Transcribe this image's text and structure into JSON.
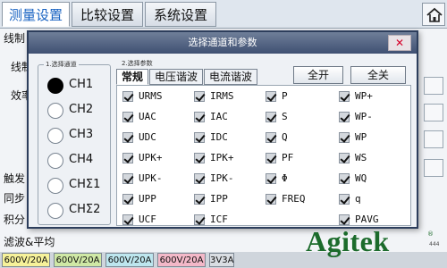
{
  "top_tabs": [
    {
      "label": "测量设置",
      "active": true
    },
    {
      "label": "比较设置",
      "active": false
    },
    {
      "label": "系统设置",
      "active": false
    }
  ],
  "bg_labels": [
    "线制",
    "线制",
    "效率",
    "触发",
    "同步",
    "积分",
    "滤波&平均"
  ],
  "status_cells": [
    {
      "label": "600V/20A",
      "color": "#f6f29a"
    },
    {
      "label": "600V/20A",
      "color": "#cfe8a5"
    },
    {
      "label": "600V/20A",
      "color": "#bde6ee"
    },
    {
      "label": "600V/20A",
      "color": "#f3b8c8"
    },
    {
      "label": "3V3A",
      "color": "#d9dde2"
    }
  ],
  "dialog": {
    "title": "选择通道和参数",
    "close": "✕",
    "channel_group_title": "1.选择通道",
    "channels": [
      {
        "label": "CH1",
        "selected": true
      },
      {
        "label": "CH2",
        "selected": false
      },
      {
        "label": "CH3",
        "selected": false
      },
      {
        "label": "CH4",
        "selected": false
      },
      {
        "label": "CHΣ1",
        "selected": false
      },
      {
        "label": "CHΣ2",
        "selected": false
      }
    ],
    "param_group_title": "2.选择参数",
    "param_tabs": [
      {
        "label": "常规",
        "active": true
      },
      {
        "label": "电压谐波",
        "active": false
      },
      {
        "label": "电流谐波",
        "active": false
      }
    ],
    "buttons": {
      "all_on": "全开",
      "all_off": "全关"
    },
    "params": [
      [
        "URMS",
        "IRMS",
        "P",
        "WP+"
      ],
      [
        "UAC",
        "IAC",
        "S",
        "WP-"
      ],
      [
        "UDC",
        "IDC",
        "Q",
        "WP"
      ],
      [
        "UPK+",
        "IPK+",
        "PF",
        "WS"
      ],
      [
        "UPK-",
        "IPK-",
        "Φ",
        "WQ"
      ],
      [
        "UPP",
        "IPP",
        "FREQ",
        "q"
      ],
      [
        "UCF",
        "ICF",
        "",
        "PAVG"
      ]
    ]
  },
  "brand": {
    "logo": "Agitek",
    "reg": "®",
    "corner": "444"
  }
}
